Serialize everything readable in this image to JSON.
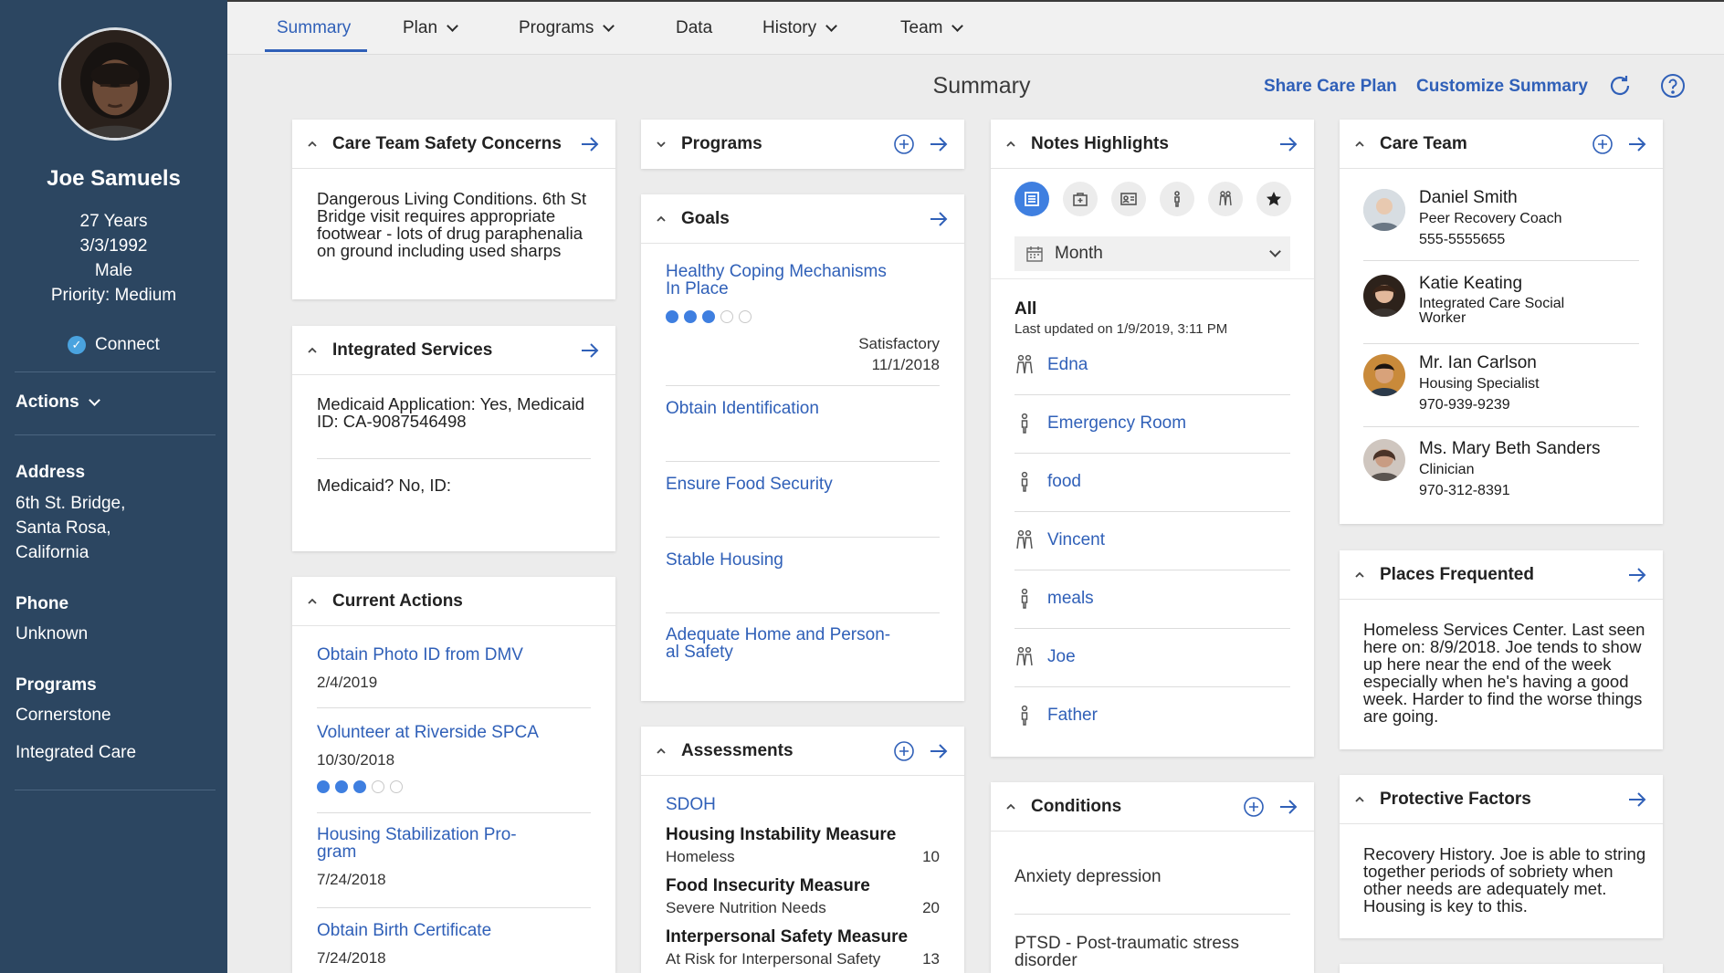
{
  "nav": {
    "tabs": [
      {
        "label": "Summary"
      },
      {
        "label": "Plan"
      },
      {
        "label": "Programs"
      },
      {
        "label": "Data"
      },
      {
        "label": "History"
      },
      {
        "label": "Team"
      }
    ]
  },
  "patient": {
    "name": "Joe Samuels",
    "age": "27 Years",
    "dob": "3/3/1992",
    "gender": "Male",
    "priority": "Priority: Medium",
    "connect_label": "Connect",
    "actions_label": "Actions",
    "address_heading": "Address",
    "address_lines": [
      "6th St. Bridge,",
      "Santa Rosa,",
      "California"
    ],
    "phone_heading": "Phone",
    "phone": "Unknown",
    "programs_heading": "Programs",
    "programs": [
      "Cornerstone",
      "Integrated Care"
    ]
  },
  "header": {
    "title": "Summary",
    "share_label": "Share Care Plan",
    "customize_label": "Customize Summary"
  },
  "safety": {
    "title": "Care Team Safety Concerns",
    "text": "Dangerous Living Conditions. 6th St Bridge visit requires appropriate footwear - lots of drug paraphenalia on ground including used sharps"
  },
  "services": {
    "title": "Integrated Services",
    "item1": "Medicaid Application: Yes, Medicaid ID: CA-9087546498",
    "item2": "Medicaid? No, ID:"
  },
  "actions": {
    "title": "Current Actions",
    "items": [
      {
        "label": "Obtain Photo ID from DMV",
        "date": "2/4/2019"
      },
      {
        "label": "Volunteer at Riverside SPCA",
        "date": "10/30/2018",
        "progress_filled": 3,
        "progress_total": 5
      },
      {
        "label": "Housing Stabilization Pro-gram",
        "date": "7/24/2018"
      },
      {
        "label": "Obtain Birth Certificate",
        "date": "7/24/2018"
      }
    ]
  },
  "programs_card": {
    "title": "Programs"
  },
  "goals": {
    "title": "Goals",
    "items": [
      {
        "label": "Healthy Coping Mechanisms In Place",
        "status": "Satisfactory",
        "date": "11/1/2018",
        "progress_filled": 3,
        "progress_total": 5
      },
      {
        "label": "Obtain Identification"
      },
      {
        "label": "Ensure Food Security"
      },
      {
        "label": "Stable Housing"
      },
      {
        "label": "Adequate Home and Person-al Safety"
      }
    ]
  },
  "assessments": {
    "title": "Assessments",
    "category": "SDOH",
    "items": [
      {
        "name": "Housing Instability Measure",
        "detail": "Homeless",
        "score": "10"
      },
      {
        "name": "Food Insecurity Measure",
        "detail": "Severe Nutrition Needs",
        "score": "20"
      },
      {
        "name": "Interpersonal Safety Measure",
        "detail": "At Risk for Interpersonal Safety",
        "score": "13"
      }
    ]
  },
  "notes": {
    "title": "Notes Highlights",
    "filter_label": "Month",
    "all_label": "All",
    "updated": "Last updated on 1/9/2019, 3:11 PM",
    "items": [
      {
        "label": "Edna",
        "icon": "group-icon"
      },
      {
        "label": "Emergency Room",
        "icon": "person-icon"
      },
      {
        "label": "food",
        "icon": "person-icon"
      },
      {
        "label": "Vincent",
        "icon": "group-icon"
      },
      {
        "label": "meals",
        "icon": "person-icon"
      },
      {
        "label": "Joe",
        "icon": "group-icon"
      },
      {
        "label": "Father",
        "icon": "person-icon"
      }
    ]
  },
  "conditions": {
    "title": "Conditions",
    "items": [
      "Anxiety depression",
      "PTSD - Post-traumatic stress disorder"
    ]
  },
  "care_team": {
    "title": "Care Team",
    "members": [
      {
        "name": "Daniel Smith",
        "role": "Peer Recovery Coach",
        "phone": "555-5555655"
      },
      {
        "name": "Katie Keating",
        "role": "Integrated Care Social Worker",
        "phone": ""
      },
      {
        "name": "Mr. Ian Carlson",
        "role": "Housing Specialist",
        "phone": "970-939-9239"
      },
      {
        "name": "Ms. Mary Beth Sanders",
        "role": "Clinician",
        "phone": "970-312-8391"
      }
    ]
  },
  "places": {
    "title": "Places Frequented",
    "text": "Homeless Services Center. Last seen here on: 8/9/2018. Joe tends to show up here near the end of the week especially when he's having a good week. Harder to find the worse things are going."
  },
  "protective": {
    "title": "Protective Factors",
    "text": "Recovery History. Joe is able to string together periods of sobriety when other needs are adequately met. Housing is key to this."
  },
  "colors": {
    "sidebar": "#2c4661",
    "accent": "#3060b8",
    "progress": "#3f7fe0"
  }
}
